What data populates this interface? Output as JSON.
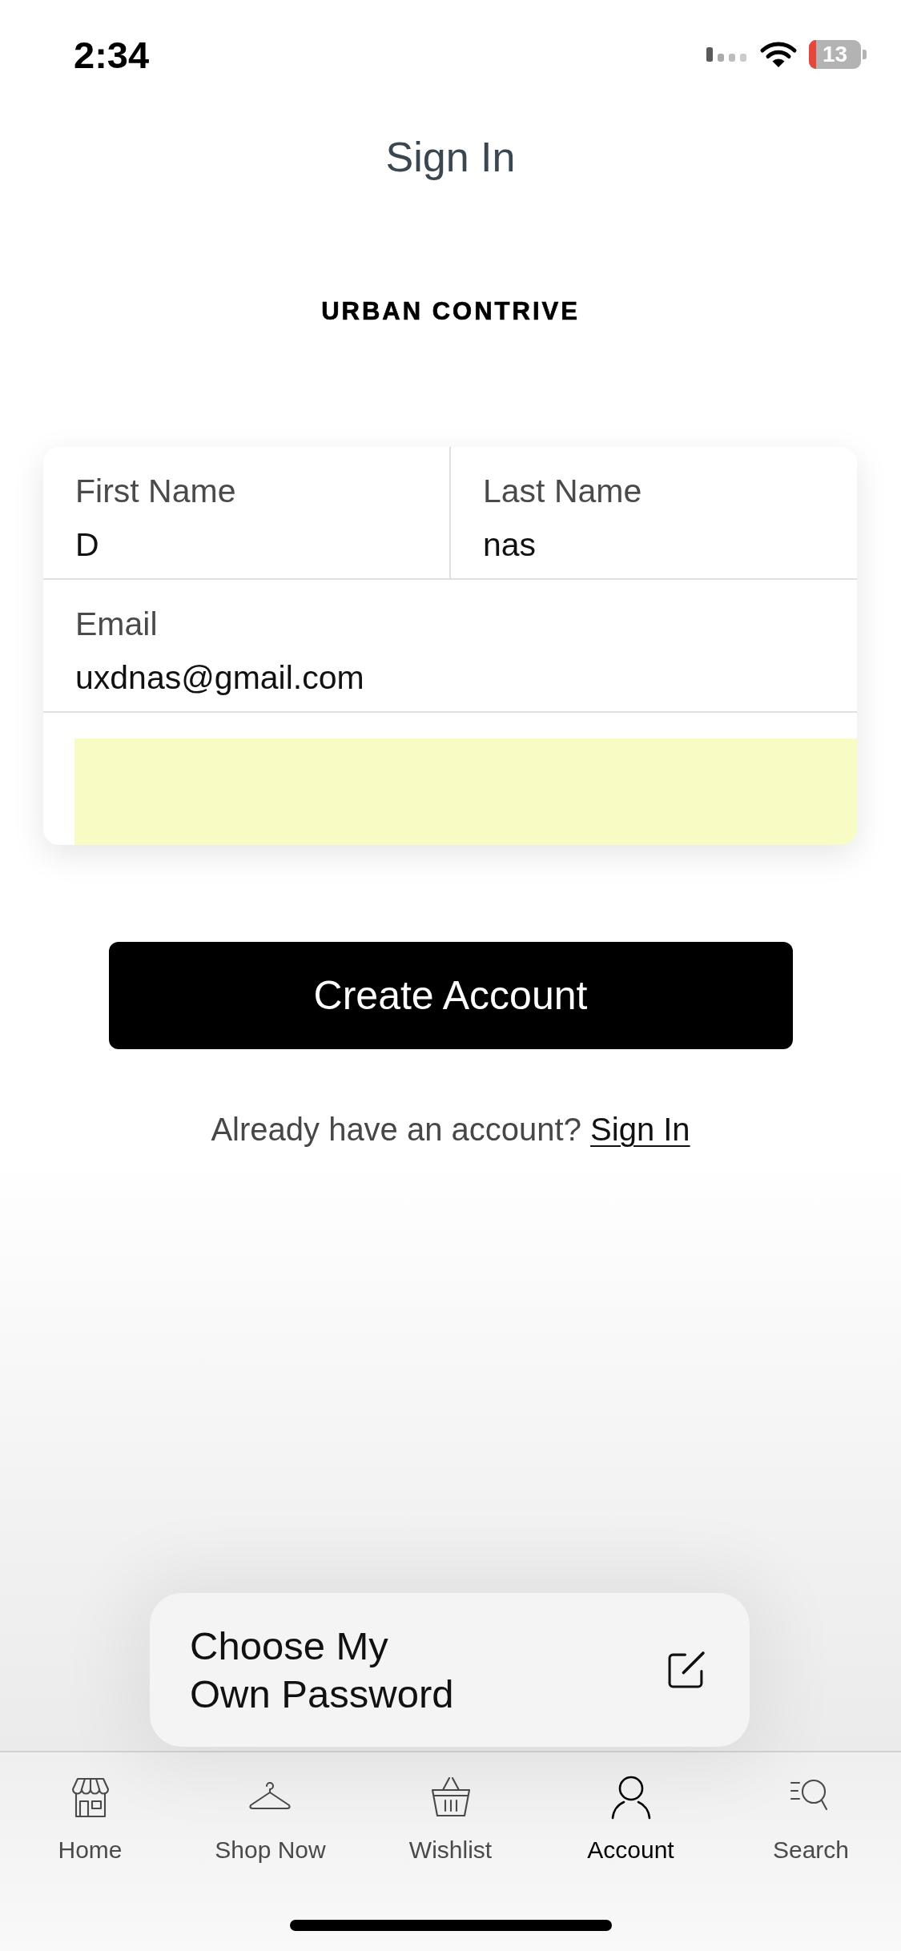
{
  "status_bar": {
    "time": "2:34",
    "battery": "13"
  },
  "header": {
    "title": "Sign In"
  },
  "brand": {
    "name": "URBAN CONTRIVE"
  },
  "form": {
    "rows": [
      {
        "fields": [
          {
            "label": "First Name",
            "value": "D"
          },
          {
            "label": "Last Name",
            "value": "nas"
          }
        ]
      },
      {
        "fields": [
          {
            "label": "Email",
            "value": "uxdnas@gmail.com"
          }
        ]
      }
    ],
    "blank_field": {
      "highlighted": true
    }
  },
  "primary_button": {
    "label": "Create Account"
  },
  "signin_prompt": {
    "text": "Already have an account?",
    "link": "Sign In"
  },
  "password_option": {
    "lines": [
      "Choose My",
      "Own Password"
    ]
  },
  "tab_bar": {
    "tabs": [
      {
        "label": "Home",
        "selected": false
      },
      {
        "label": "Shop Now",
        "selected": false
      },
      {
        "label": "Wishlist",
        "selected": false
      },
      {
        "label": "Account",
        "selected": true
      },
      {
        "label": "Search",
        "selected": false
      }
    ]
  }
}
